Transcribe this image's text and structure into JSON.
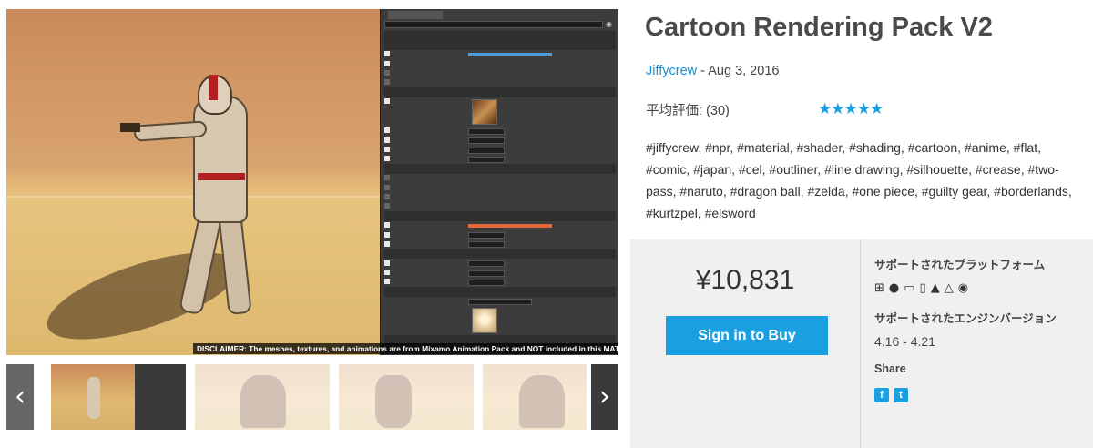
{
  "product": {
    "title": "Cartoon Rendering Pack V2",
    "author": "Jiffycrew",
    "date_sep": " - ",
    "date": "Aug 3, 2016",
    "rating_label": "平均評価:",
    "rating_count": "(30)",
    "rating_stars": "★★★★★",
    "tags": "#jiffycrew, #npr, #material, #shader, #shading, #cartoon, #anime, #flat, #comic, #japan, #cel, #outliner, #line drawing, #silhouette, #crease, #two-pass, #naruto, #dragon ball, #zelda, #one piece, #guilty gear, #borderlands, #kurtzpel, #elsword"
  },
  "purchase": {
    "price": "¥10,831",
    "buy_label": "Sign in to Buy",
    "platforms_label": "サポートされたプラットフォーム",
    "platform_icons": [
      "windows-icon",
      "apple-icon",
      "laptop-icon",
      "phone-icon",
      "android-icon",
      "linux-icon",
      "vr-icon"
    ],
    "engine_label": "サポートされたエンジンバージョン",
    "engine_versions": "4.16 - 4.21",
    "share_label": "Share",
    "share_icons": [
      "facebook-icon",
      "twitter-icon"
    ]
  },
  "gallery": {
    "disclaimer": "DISCLAIMER: The meshes, textures, and animations are from Mixamo Animation Pack and NOT included in this MATERIAL pack.",
    "prev_arrow": "‹",
    "next_arrow": "›"
  },
  "colors": {
    "accent": "#1a9fe0",
    "link": "#1a8fd1",
    "buybox_bg": "#f0f0f0"
  }
}
